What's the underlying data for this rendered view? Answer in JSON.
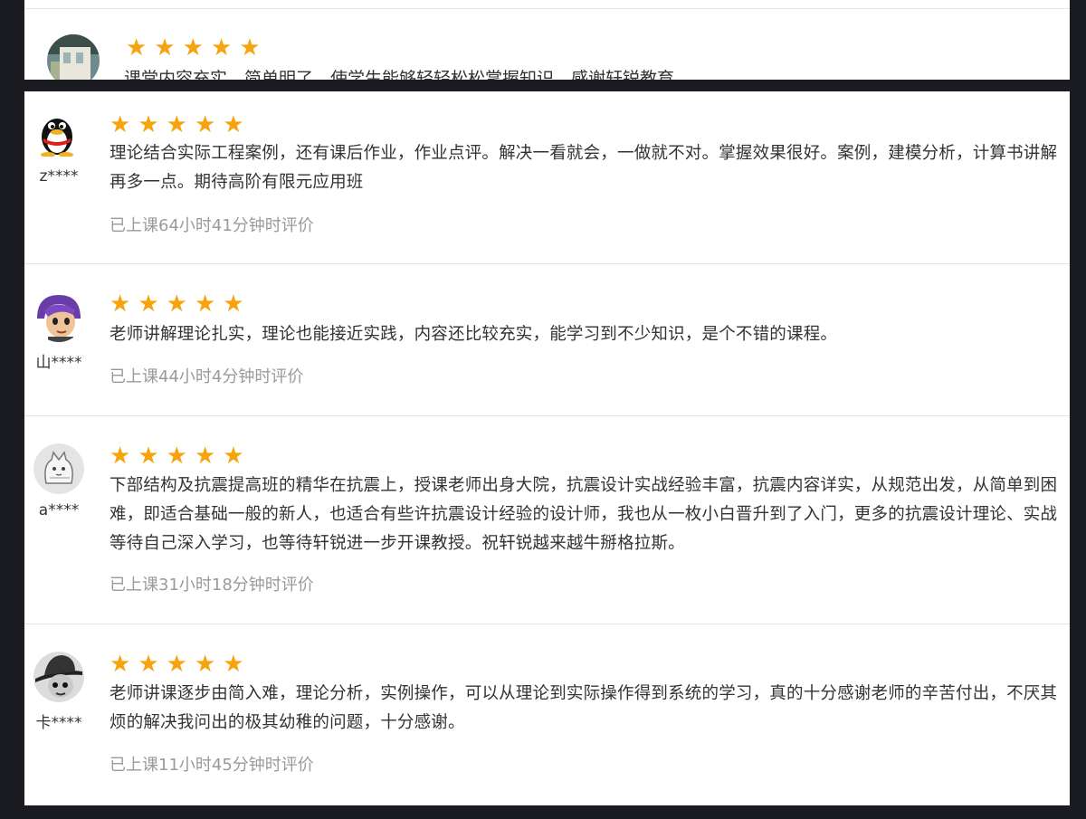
{
  "top_review": {
    "stars": [
      "★",
      "★",
      "★",
      "★",
      "★"
    ],
    "text": "课堂内容充实，简单明了，使学生能够轻轻松松掌握知识，感谢轩锐教育"
  },
  "reviews": [
    {
      "username": "z****",
      "avatar_icon": "penguin-avatar-icon",
      "stars": [
        "★",
        "★",
        "★",
        "★",
        "★"
      ],
      "rating": 5,
      "content": "理论结合实际工程案例，还有课后作业，作业点评。解决一看就会，一做就不对。掌握效果很好。案例，建模分析，计算书讲解再多一点。期待高阶有限元应用班",
      "meta": "已上课64小时41分钟时评价"
    },
    {
      "username": "山****",
      "avatar_icon": "cartoon-purple-hair-avatar-icon",
      "stars": [
        "★",
        "★",
        "★",
        "★",
        "★"
      ],
      "rating": 5,
      "content": "老师讲解理论扎实，理论也能接近实践，内容还比较充实，能学习到不少知识，是个不错的课程。",
      "meta": "已上课44小时4分钟时评价"
    },
    {
      "username": "a****",
      "avatar_icon": "cat-sketch-avatar-icon",
      "stars": [
        "★",
        "★",
        "★",
        "★",
        "★"
      ],
      "rating": 5,
      "content": "下部结构及抗震提高班的精华在抗震上，授课老师出身大院，抗震设计实战经验丰富，抗震内容详实，从规范出发，从简单到困难，即适合基础一般的新人，也适合有些许抗震设计经验的设计师，我也从一枚小白晋升到了入门，更多的抗震设计理论、实战等待自己深入学习，也等待轩锐进一步开课教授。祝轩锐越来越牛掰格拉斯。",
      "meta": "已上课31小时18分钟时评价"
    },
    {
      "username": "卡****",
      "avatar_icon": "hat-character-avatar-icon",
      "stars": [
        "★",
        "★",
        "★",
        "★",
        "★"
      ],
      "rating": 5,
      "content": "老师讲课逐步由简入难，理论分析，实例操作，可以从理论到实际操作得到系统的学习，真的十分感谢老师的辛苦付出，不厌其烦的解决我问出的极其幼稚的问题，十分感谢。",
      "meta": "已上课11小时45分钟时评价"
    }
  ]
}
